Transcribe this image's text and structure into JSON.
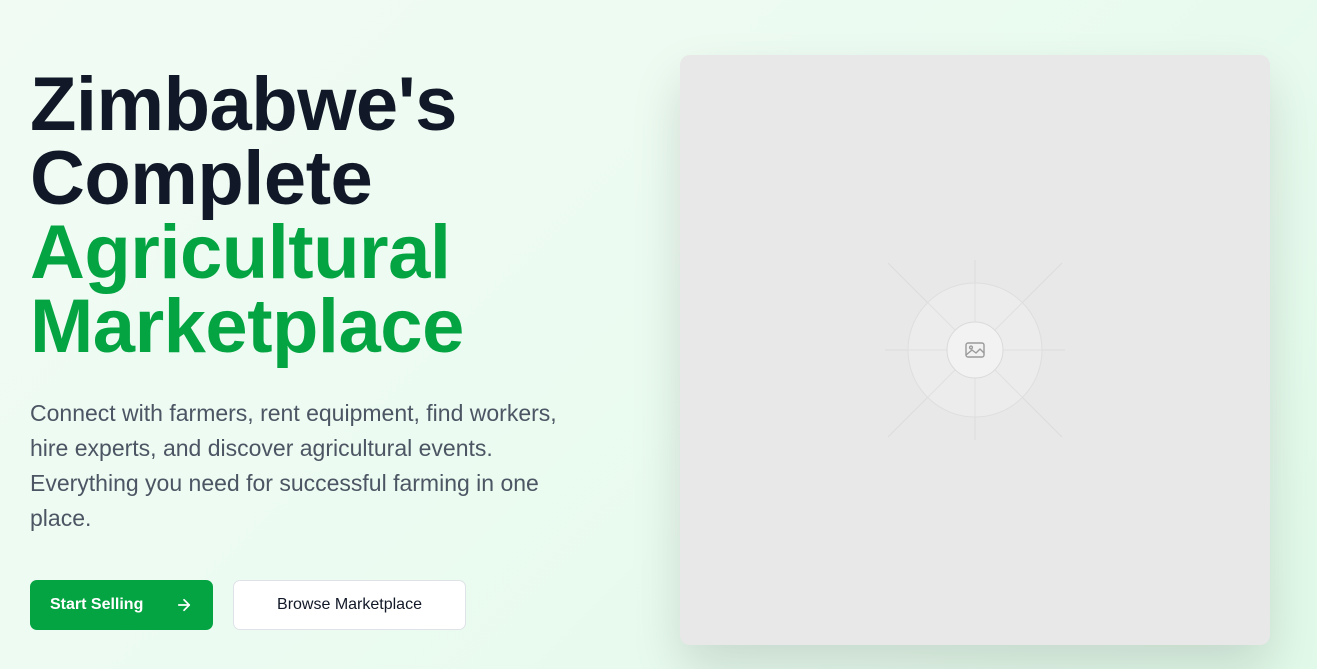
{
  "hero": {
    "headline_line1": "Zimbabwe's",
    "headline_line2": "Complete",
    "headline_line3": "Agricultural",
    "headline_line4": "Marketplace",
    "subtitle": "Connect with farmers, rent equipment, find workers, hire experts, and discover agricultural events. Everything you need for successful farming in one place."
  },
  "actions": {
    "primary_label": "Start Selling",
    "primary_icon": "arrow-right-icon",
    "secondary_label": "Browse Marketplace"
  },
  "media": {
    "icon": "image-placeholder-icon"
  },
  "colors": {
    "brand_green": "#05a443",
    "heading_dark": "#111827",
    "body_gray": "#4b5563",
    "placeholder_bg": "#e8e8e8"
  }
}
